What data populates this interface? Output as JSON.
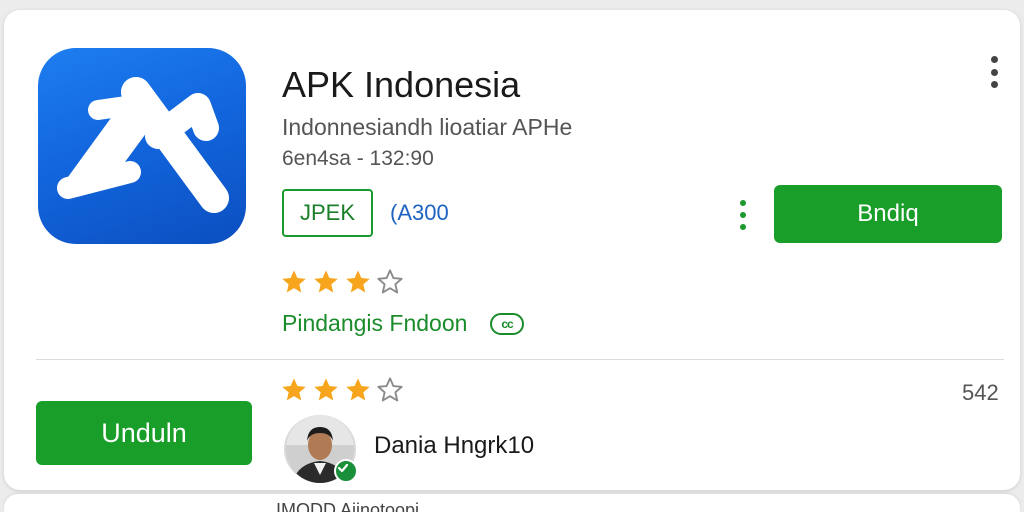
{
  "app": {
    "title": "APK Indonesia",
    "subtitle": "Indonnesiandh lioatiar APHe",
    "meta": "6en4sa - 132:90",
    "tag_label": "JPEK",
    "size_label": "(A300",
    "install_label": "Bndiq",
    "rating_stars": 3,
    "rating_max": 4,
    "developer_label": "Pindangis Fndoon",
    "badge_label": "cc"
  },
  "review": {
    "download_label": "Unduln",
    "rating_stars": 3,
    "rating_max": 4,
    "count": "542",
    "reviewer_name": "Dania Hngrk10"
  },
  "next_card": {
    "text": "IMODD Ajinotoopi"
  },
  "colors": {
    "green": "#1a9e2a",
    "star": "#f7a51c",
    "icon_blue": "#1366de"
  }
}
